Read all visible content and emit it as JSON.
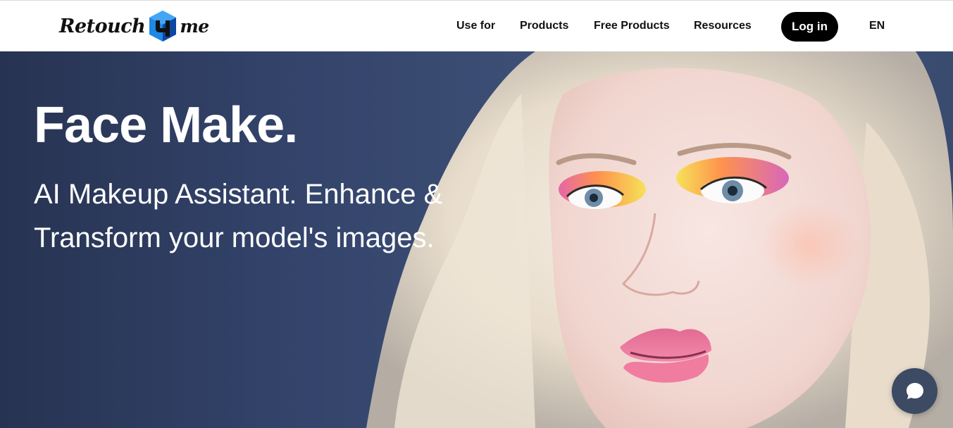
{
  "logo": {
    "word_left": "Retouch",
    "word_right": "me",
    "icon": "cube-icon",
    "cube_colors": [
      "#1e88e5",
      "#0d47a1",
      "#42a5f5"
    ]
  },
  "nav": {
    "items": [
      {
        "label": "Use for"
      },
      {
        "label": "Products"
      },
      {
        "label": "Free Products"
      },
      {
        "label": "Resources"
      }
    ],
    "login_label": "Log in",
    "language": "EN"
  },
  "hero": {
    "title": "Face Make.",
    "subtitle": "AI Makeup Assistant. Enhance & Transform your model's images."
  },
  "chat": {
    "icon": "chat-bubble-icon"
  },
  "colors": {
    "hero_bg": "#33436a",
    "accent": "#000000"
  }
}
